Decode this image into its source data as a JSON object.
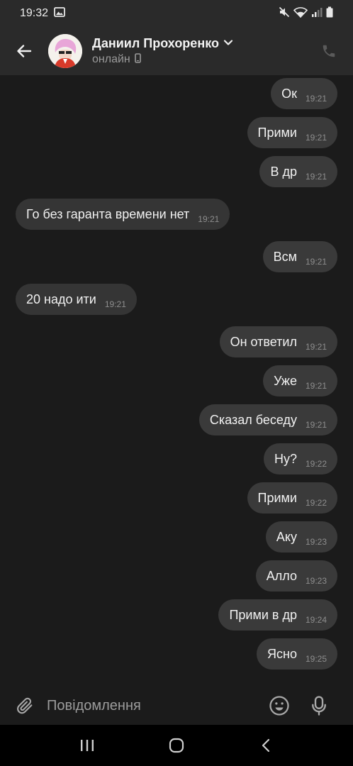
{
  "status_bar": {
    "time": "19:32",
    "icons": [
      "image-icon",
      "mute-icon",
      "wifi-icon",
      "signal-icon",
      "battery-icon"
    ]
  },
  "header": {
    "contact_name": "Даниил Прохоренко",
    "status": "онлайн",
    "icons": [
      "back-arrow-icon",
      "chevron-down-icon",
      "mobile-device-icon",
      "phone-icon"
    ]
  },
  "messages": [
    {
      "text": "Ок",
      "time": "19:21",
      "direction": "outgoing"
    },
    {
      "text": "Прими",
      "time": "19:21",
      "direction": "outgoing"
    },
    {
      "text": "В др",
      "time": "19:21",
      "direction": "outgoing"
    },
    {
      "text": "Го без гаранта времени нет",
      "time": "19:21",
      "direction": "incoming"
    },
    {
      "text": "Всм",
      "time": "19:21",
      "direction": "outgoing"
    },
    {
      "text": "20 надо ити",
      "time": "19:21",
      "direction": "incoming"
    },
    {
      "text": "Он ответил",
      "time": "19:21",
      "direction": "outgoing"
    },
    {
      "text": "Уже",
      "time": "19:21",
      "direction": "outgoing"
    },
    {
      "text": "Сказал беседу",
      "time": "19:21",
      "direction": "outgoing"
    },
    {
      "text": "Ну?",
      "time": "19:22",
      "direction": "outgoing"
    },
    {
      "text": "Прими",
      "time": "19:22",
      "direction": "outgoing"
    },
    {
      "text": "Аку",
      "time": "19:23",
      "direction": "outgoing"
    },
    {
      "text": "Алло",
      "time": "19:23",
      "direction": "outgoing"
    },
    {
      "text": "Прими в др",
      "time": "19:24",
      "direction": "outgoing"
    },
    {
      "text": "Ясно",
      "time": "19:25",
      "direction": "outgoing"
    }
  ],
  "composer": {
    "placeholder": "Повідомлення",
    "icons": [
      "paperclip-icon",
      "emoji-icon",
      "microphone-icon"
    ]
  },
  "navigation": {
    "icons": [
      "recent-apps-icon",
      "home-icon",
      "back-icon"
    ]
  },
  "colors": {
    "background": "#1b1b1b",
    "header": "#2a2a2a",
    "bubble": "#3a3a3a"
  }
}
